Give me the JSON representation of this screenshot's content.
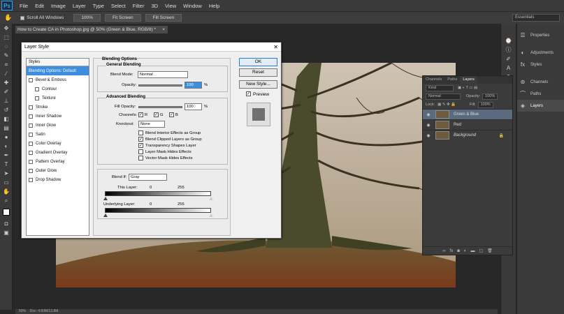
{
  "app": {
    "logo": "Ps",
    "menus": [
      "File",
      "Edit",
      "Image",
      "Layer",
      "Type",
      "Select",
      "Filter",
      "3D",
      "View",
      "Window",
      "Help"
    ]
  },
  "options": {
    "scroll_all": "Scroll All Windows",
    "btn1": "100%",
    "btn2": "Fit Screen",
    "btn3": "Fill Screen",
    "workspace": "Essentials"
  },
  "document": {
    "tab_title": "How to Create CA in Photoshop.jpg @ 50% (Green & Blue, RGB/8) *",
    "zoom": "50%",
    "status": "Doc: 4.60M/13.8M"
  },
  "right_panel": {
    "items": [
      "Properties",
      "Adjustments",
      "Styles",
      "Channels",
      "Paths",
      "Layers"
    ]
  },
  "layers_panel": {
    "tabs": [
      "Channels",
      "Paths",
      "Layers"
    ],
    "kind": "Kind",
    "blend": "Normal",
    "opacity_label": "Opacity:",
    "opacity": "100%",
    "lock_label": "Lock:",
    "fill_label": "Fill:",
    "fill": "100%",
    "layers": [
      {
        "name": "Green & Blue",
        "selected": true
      },
      {
        "name": "Red",
        "selected": false
      },
      {
        "name": "Background",
        "selected": false
      }
    ]
  },
  "dialog": {
    "title": "Layer Style",
    "styles_header": "Styles",
    "style_items": [
      {
        "label": "Blending Options: Default",
        "check": false,
        "selected": true,
        "indent": false
      },
      {
        "label": "Bevel & Emboss",
        "check": true,
        "indent": false
      },
      {
        "label": "Contour",
        "check": true,
        "indent": true
      },
      {
        "label": "Texture",
        "check": true,
        "indent": true
      },
      {
        "label": "Stroke",
        "check": true,
        "indent": false
      },
      {
        "label": "Inner Shadow",
        "check": true,
        "indent": false
      },
      {
        "label": "Inner Glow",
        "check": true,
        "indent": false
      },
      {
        "label": "Satin",
        "check": true,
        "indent": false
      },
      {
        "label": "Color Overlay",
        "check": true,
        "indent": false
      },
      {
        "label": "Gradient Overlay",
        "check": true,
        "indent": false
      },
      {
        "label": "Pattern Overlay",
        "check": true,
        "indent": false
      },
      {
        "label": "Outer Glow",
        "check": true,
        "indent": false
      },
      {
        "label": "Drop Shadow",
        "check": true,
        "indent": false
      }
    ],
    "blending_title": "Blending Options",
    "general_title": "General Blending",
    "blend_mode_label": "Blend Mode:",
    "blend_mode": "Normal",
    "opacity_label": "Opacity:",
    "opacity": "100",
    "pct": "%",
    "advanced_title": "Advanced Blending",
    "fill_opacity_label": "Fill Opacity:",
    "fill_opacity": "100",
    "channels_label": "Channels:",
    "ch_r": "R",
    "ch_g": "G",
    "ch_b": "B",
    "knockout_label": "Knockout:",
    "knockout": "None",
    "opts": [
      {
        "label": "Blend Interior Effects as Group",
        "on": false
      },
      {
        "label": "Blend Clipped Layers as Group",
        "on": true
      },
      {
        "label": "Transparency Shapes Layer",
        "on": true
      },
      {
        "label": "Layer Mask Hides Effects",
        "on": false
      },
      {
        "label": "Vector Mask Hides Effects",
        "on": false
      }
    ],
    "blend_if_label": "Blend If:",
    "blend_if": "Gray",
    "this_layer": "This Layer:",
    "underlying": "Underlying Layer:",
    "v0": "0",
    "v255": "255",
    "ok": "OK",
    "reset": "Reset",
    "new_style": "New Style...",
    "preview": "Preview"
  }
}
